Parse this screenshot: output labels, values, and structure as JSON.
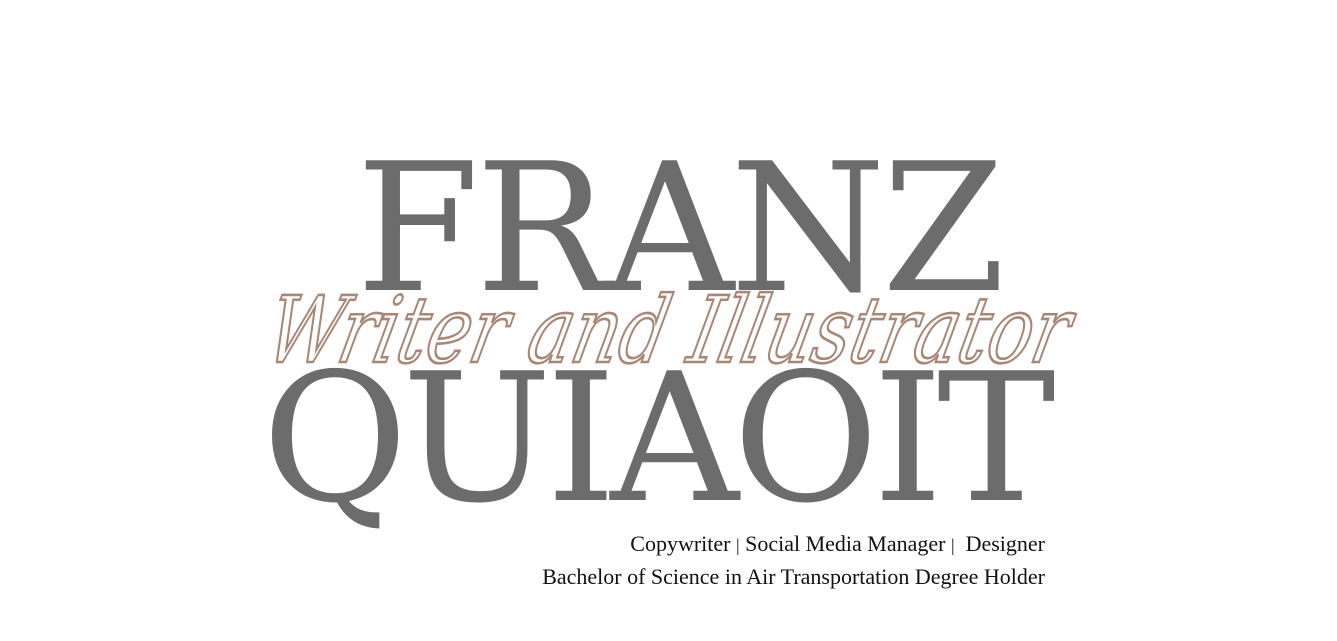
{
  "brand": {
    "first_name": "FRANZ",
    "last_name": "QUIAOIT",
    "script_title": "Writer and Illustrator"
  },
  "roles": {
    "role_1": "Copywriter",
    "separator": "|",
    "role_2": "Social Media Manager",
    "role_3": "Designer"
  },
  "degree": "Bachelor of Science in Air Transportation Degree Holder",
  "colors": {
    "name_gray": "#6c6c6c",
    "script_rose": "#a88776",
    "text_black": "#111111"
  }
}
